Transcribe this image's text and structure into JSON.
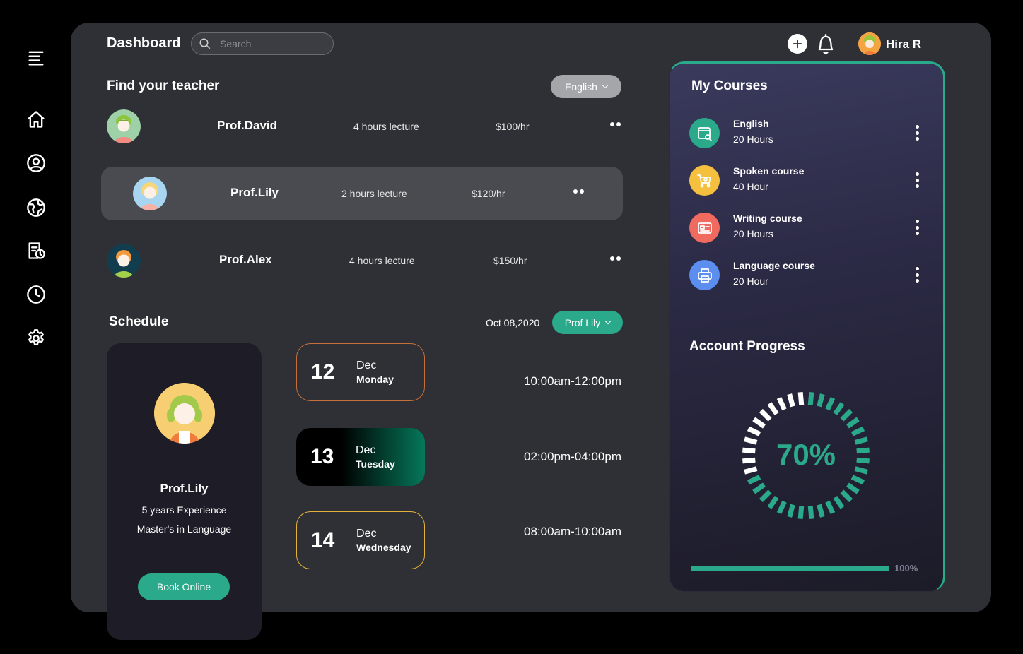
{
  "sidebar": {
    "items": [
      {
        "icon": "menu-icon"
      },
      {
        "icon": "home-icon"
      },
      {
        "icon": "user-icon"
      },
      {
        "icon": "globe-icon"
      },
      {
        "icon": "schedule-document-icon"
      },
      {
        "icon": "clock-icon"
      },
      {
        "icon": "settings-icon"
      }
    ]
  },
  "header": {
    "title": "Dashboard",
    "search_placeholder": "Search",
    "user_name": "Hira R"
  },
  "teachers": {
    "title": "Find your teacher",
    "language_filter": "English",
    "rows": [
      {
        "name": "Prof.David",
        "lecture": "4 hours lecture",
        "price": "$100/hr",
        "active": false
      },
      {
        "name": "Prof.Lily",
        "lecture": "2 hours lecture",
        "price": "$120/hr",
        "active": true
      },
      {
        "name": "Prof.Alex",
        "lecture": "4 hours lecture",
        "price": "$150/hr",
        "active": false
      }
    ]
  },
  "schedule": {
    "title": "Schedule",
    "date": "Oct 08,2020",
    "teacher_filter": "Prof Lily",
    "profile": {
      "name": "Prof.Lily",
      "experience": "5 years Experience",
      "degree": "Master's in Language",
      "button": "Book Online"
    },
    "days": [
      {
        "num": "12",
        "month": "Dec",
        "weekday": "Monday",
        "time": "10:00am-12:00pm"
      },
      {
        "num": "13",
        "month": "Dec",
        "weekday": "Tuesday",
        "time": "02:00pm-04:00pm"
      },
      {
        "num": "14",
        "month": "Dec",
        "weekday": "Wednesday",
        "time": "08:00am-10:00am"
      }
    ]
  },
  "courses": {
    "title": "My Courses",
    "items": [
      {
        "name": "English",
        "hours": "20 Hours",
        "color": "#2aa98b",
        "icon": "browser-search-icon"
      },
      {
        "name": "Spoken course",
        "hours": "40 Hour",
        "color": "#f6c03f",
        "icon": "cart-search-icon"
      },
      {
        "name": "Writing course",
        "hours": "20 Hours",
        "color": "#f06a60",
        "icon": "id-card-icon"
      },
      {
        "name": "Language course",
        "hours": "20 Hour",
        "color": "#5c8ef0",
        "icon": "printer-icon"
      }
    ]
  },
  "progress": {
    "title": "Account Progress",
    "percent": 70,
    "percent_label": "70%",
    "bar_percent": 100,
    "bar_label": "100%",
    "accent": "#2aa98b"
  }
}
